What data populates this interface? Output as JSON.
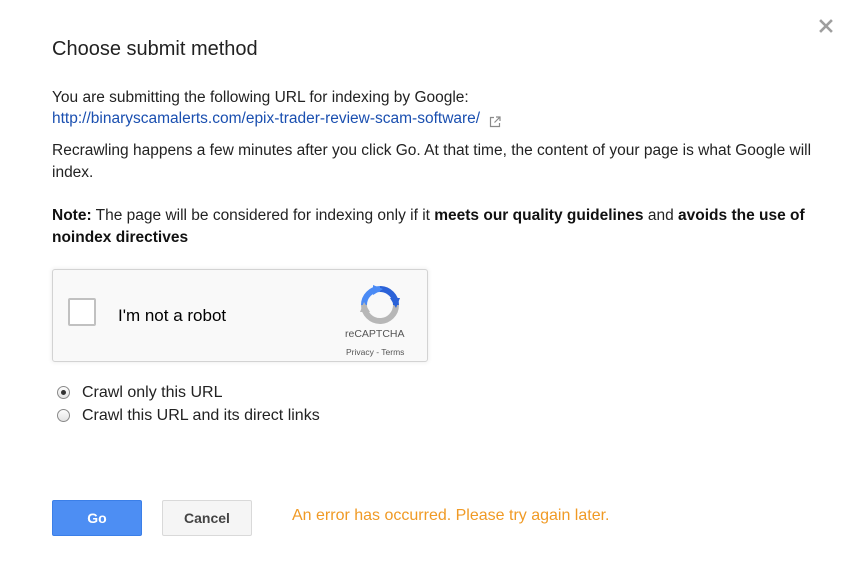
{
  "dialog": {
    "title": "Choose submit method",
    "close_icon": "close-icon"
  },
  "intro": {
    "text": "You are submitting the following URL for indexing by Google:",
    "url": "http://binaryscamalerts.com/epix-trader-review-scam-software/",
    "link_icon": "external-link-icon"
  },
  "recrawl_text": "Recrawling happens a few minutes after you click Go. At that time, the content of your page is what Google will index.",
  "note": {
    "label": "Note:",
    "text1": " The page will be considered for indexing only if it ",
    "bold1": "meets our quality guidelines",
    "text2": " and ",
    "bold2": "avoids the use of noindex directives"
  },
  "captcha": {
    "label": "I'm not a robot",
    "brand": "reCAPTCHA",
    "privacy": "Privacy",
    "separator": " - ",
    "terms": "Terms",
    "checked": false
  },
  "crawl_options": [
    {
      "label": "Crawl only this URL",
      "checked": true
    },
    {
      "label": "Crawl this URL and its direct links",
      "checked": false
    }
  ],
  "actions": {
    "go_label": "Go",
    "cancel_label": "Cancel",
    "error": "An error has occurred. Please try again later."
  },
  "colors": {
    "link": "#1a4fb0",
    "primary_button": "#4d8ef3",
    "error": "#f09a25"
  }
}
